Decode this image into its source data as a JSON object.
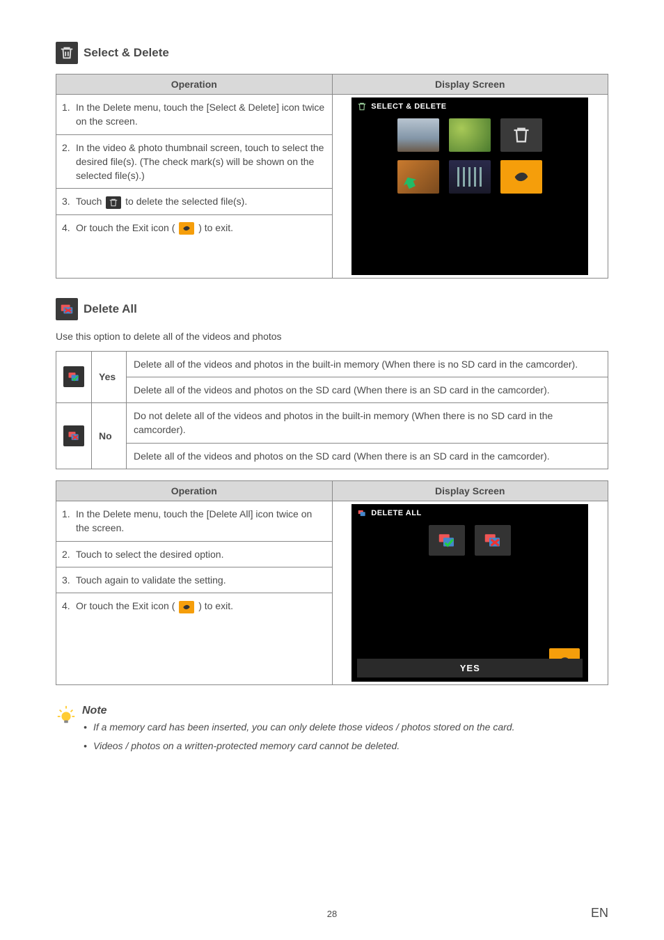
{
  "section1": {
    "title": "Select & Delete",
    "op_header": "Operation",
    "screen_header": "Display Screen",
    "steps": [
      "In the Delete menu, touch the [Select & Delete] icon twice on the screen.",
      "In the video & photo thumbnail screen, touch to select the desired file(s). (The check mark(s) will be shown on the selected file(s).)"
    ],
    "step3_pre": "Touch ",
    "step3_post": " to delete the selected file(s).",
    "step4_pre": "Or touch the Exit icon ( ",
    "step4_post": " ) to exit.",
    "panel_title": "SELECT & DELETE"
  },
  "section2": {
    "title": "Delete All",
    "intro": "Use this option to delete all of the videos and photos",
    "yes_label": "Yes",
    "yes_desc1": "Delete all of the videos and photos in the built-in memory (When there is no SD card in the camcorder).",
    "yes_desc2": "Delete all of the videos and photos on the SD card (When there is an SD card in the camcorder).",
    "no_label": "No",
    "no_desc1": "Do not delete all of the videos and photos in the built-in memory (When there is no SD card in the camcorder).",
    "no_desc2": "Delete all of the videos and photos on the SD card (When there is an SD card in the camcorder).",
    "op_header": "Operation",
    "screen_header": "Display Screen",
    "steps": [
      "In the Delete menu, touch the [Delete All] icon twice on the screen.",
      "Touch to select the desired option.",
      "Touch again to validate the setting."
    ],
    "step4_pre": "Or touch the Exit icon ( ",
    "step4_post": " ) to exit.",
    "panel_title": "DELETE ALL",
    "yes_bar": "YES"
  },
  "note": {
    "title": "Note",
    "items": [
      "If a memory card has been inserted, you can only delete those videos / photos stored on the card.",
      "Videos / photos on a written-protected memory card cannot be deleted."
    ]
  },
  "page_number": "28",
  "lang": "EN"
}
